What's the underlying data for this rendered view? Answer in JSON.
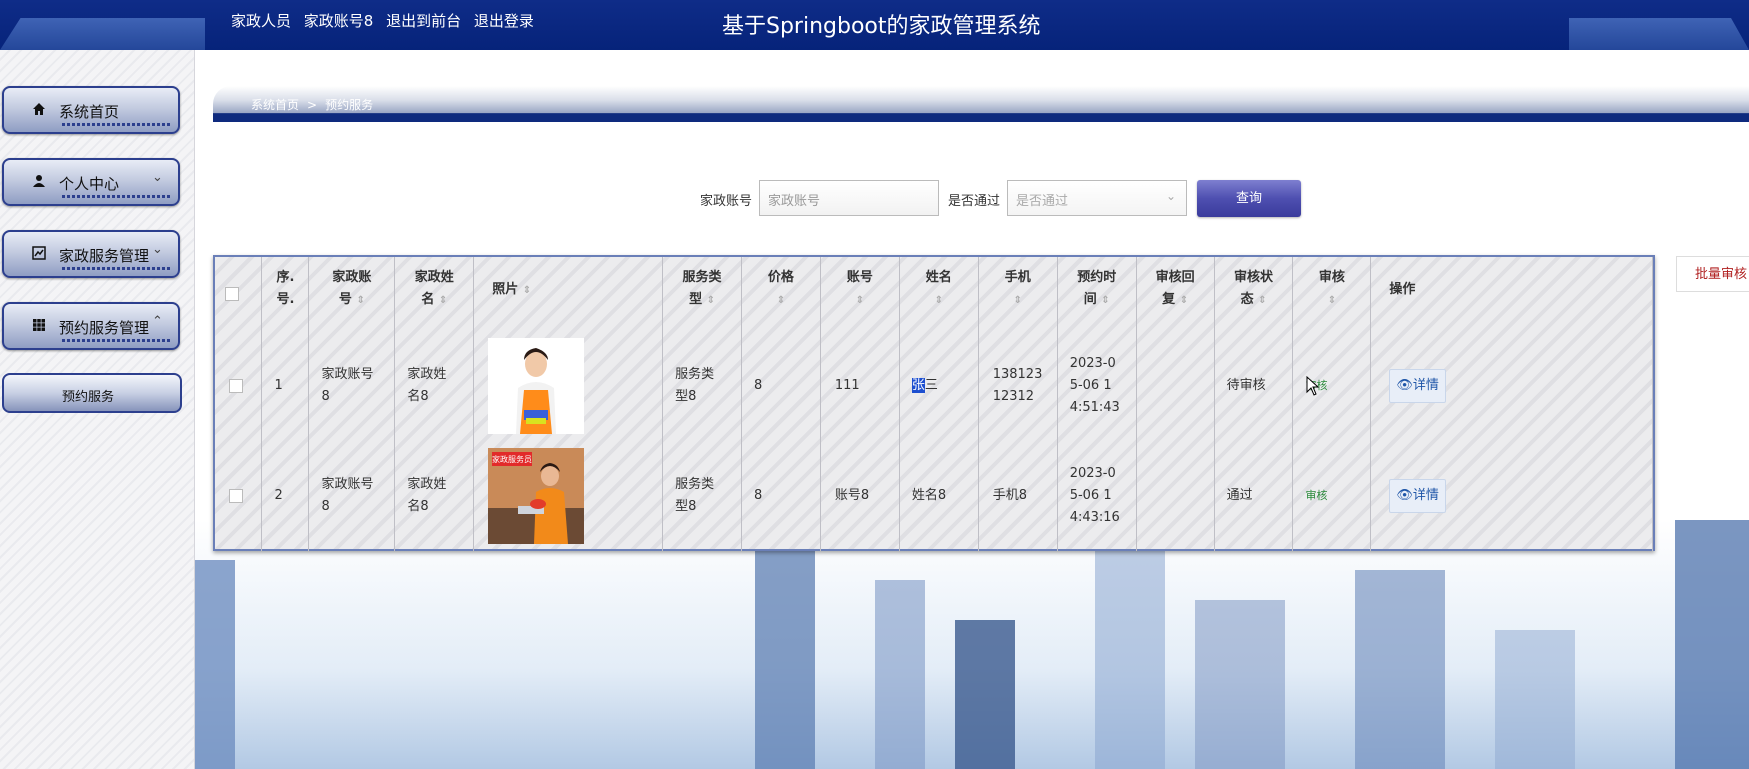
{
  "header": {
    "role": "家政人员",
    "account": "家政账号8",
    "to_front": "退出到前台",
    "logout": "退出登录",
    "title": "基于Springboot的家政管理系统"
  },
  "sidebar": {
    "items": [
      {
        "label": "系统首页",
        "icon": "home-icon"
      },
      {
        "label": "个人中心",
        "icon": "user-icon"
      },
      {
        "label": "家政服务管理",
        "icon": "chart-icon"
      },
      {
        "label": "预约服务管理",
        "icon": "grid-icon"
      }
    ],
    "sub_item": "预约服务"
  },
  "breadcrumb": {
    "home": "系统首页",
    "sep": ">",
    "current": "预约服务"
  },
  "search": {
    "account_label": "家政账号",
    "account_placeholder": "家政账号",
    "pass_label": "是否通过",
    "pass_placeholder": "是否通过",
    "query_label": "查询"
  },
  "batch_label": "批量审核",
  "table": {
    "headers": {
      "index": [
        "序.",
        "号."
      ],
      "account": [
        "家政账",
        "号"
      ],
      "name": [
        "家政姓",
        "名"
      ],
      "photo": "照片",
      "type": [
        "服务类",
        "型"
      ],
      "price": "价格",
      "acct": "账号",
      "uname": "姓名",
      "phone": "手机",
      "time": [
        "预约时",
        "间"
      ],
      "reply": [
        "审核回",
        "复"
      ],
      "state": [
        "审核状",
        "态"
      ],
      "audit": "审核",
      "ops": "操作"
    },
    "rows": [
      {
        "index": "1",
        "account": [
          "家政账号",
          "8"
        ],
        "name": [
          "家政姓",
          "名8"
        ],
        "type": [
          "服务类",
          "型8"
        ],
        "price": "8",
        "acct": "111",
        "uname_a": "张",
        "uname_b": "三",
        "phone": [
          "138123",
          "12312"
        ],
        "time": [
          "2023-0",
          "5-06 1",
          "4:51:43"
        ],
        "state": "待审核",
        "audit": "审核",
        "detail": "详情"
      },
      {
        "index": "2",
        "account": [
          "家政账号",
          "8"
        ],
        "name": [
          "家政姓",
          "名8"
        ],
        "type": [
          "服务类",
          "型8"
        ],
        "price": "8",
        "acct": "账号8",
        "uname": "姓名8",
        "phone": "手机8",
        "time": [
          "2023-0",
          "5-06 1",
          "4:43:16"
        ],
        "state": "通过",
        "audit": "审核",
        "detail": "详情"
      }
    ],
    "photo2_sign": "家政服务员"
  }
}
